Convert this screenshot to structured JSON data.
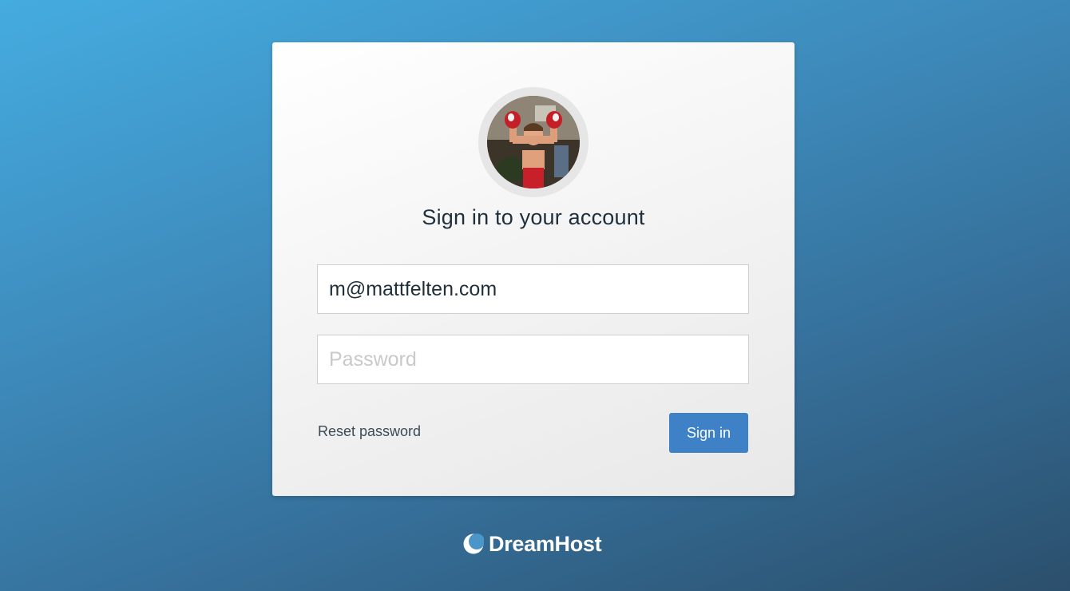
{
  "page": {
    "title": "Sign in to your account"
  },
  "form": {
    "email_value": "m@mattfelten.com",
    "password_placeholder": "Password",
    "reset_label": "Reset password",
    "submit_label": "Sign in"
  },
  "brand": {
    "name": "DreamHost",
    "icon": "dreamhost-moon-icon"
  },
  "avatar": {
    "icon": "user-avatar-photo"
  },
  "colors": {
    "accent": "#3f81c6",
    "background_start": "#45ace0",
    "background_end": "#2b4f6c",
    "text": "#1f2f3c"
  }
}
